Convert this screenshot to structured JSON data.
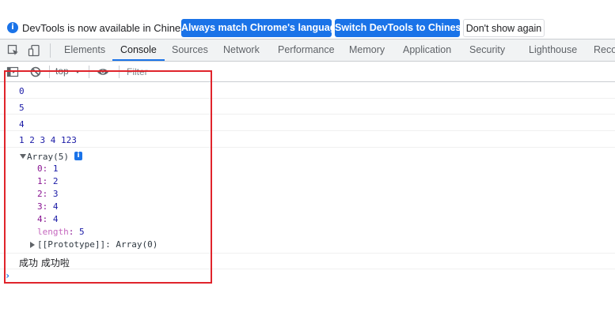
{
  "infobar": {
    "message": "DevTools is now available in Chinese!",
    "btn_match": "Always match Chrome's language",
    "btn_switch": "Switch DevTools to Chinese",
    "btn_dismiss": "Don't show again"
  },
  "tabs": [
    "Elements",
    "Console",
    "Sources",
    "Network",
    "Performance",
    "Memory",
    "Application",
    "Security",
    "Lighthouse",
    "Reco"
  ],
  "active_tab": "Console",
  "toolbar": {
    "context": "top",
    "filter_placeholder": "Filter"
  },
  "console": {
    "line0": "0",
    "line1": "5",
    "line2": "4",
    "line3": "1 2 3 4 123",
    "array_label": "Array(5)",
    "info_badge": "i",
    "props": [
      {
        "key": "0",
        "value": "1"
      },
      {
        "key": "1",
        "value": "2"
      },
      {
        "key": "2",
        "value": "3"
      },
      {
        "key": "3",
        "value": "4"
      },
      {
        "key": "4",
        "value": "4"
      }
    ],
    "length_key": "length",
    "length_value": "5",
    "prototype": "[[Prototype]]: Array(0)",
    "chinese_line": "成功 成功啦",
    "prompt": "›"
  },
  "colors": {
    "accent": "#1a73e8",
    "annotation_red": "#e0242b",
    "number_blue": "#1a1aa6",
    "key_purple": "#881391"
  }
}
